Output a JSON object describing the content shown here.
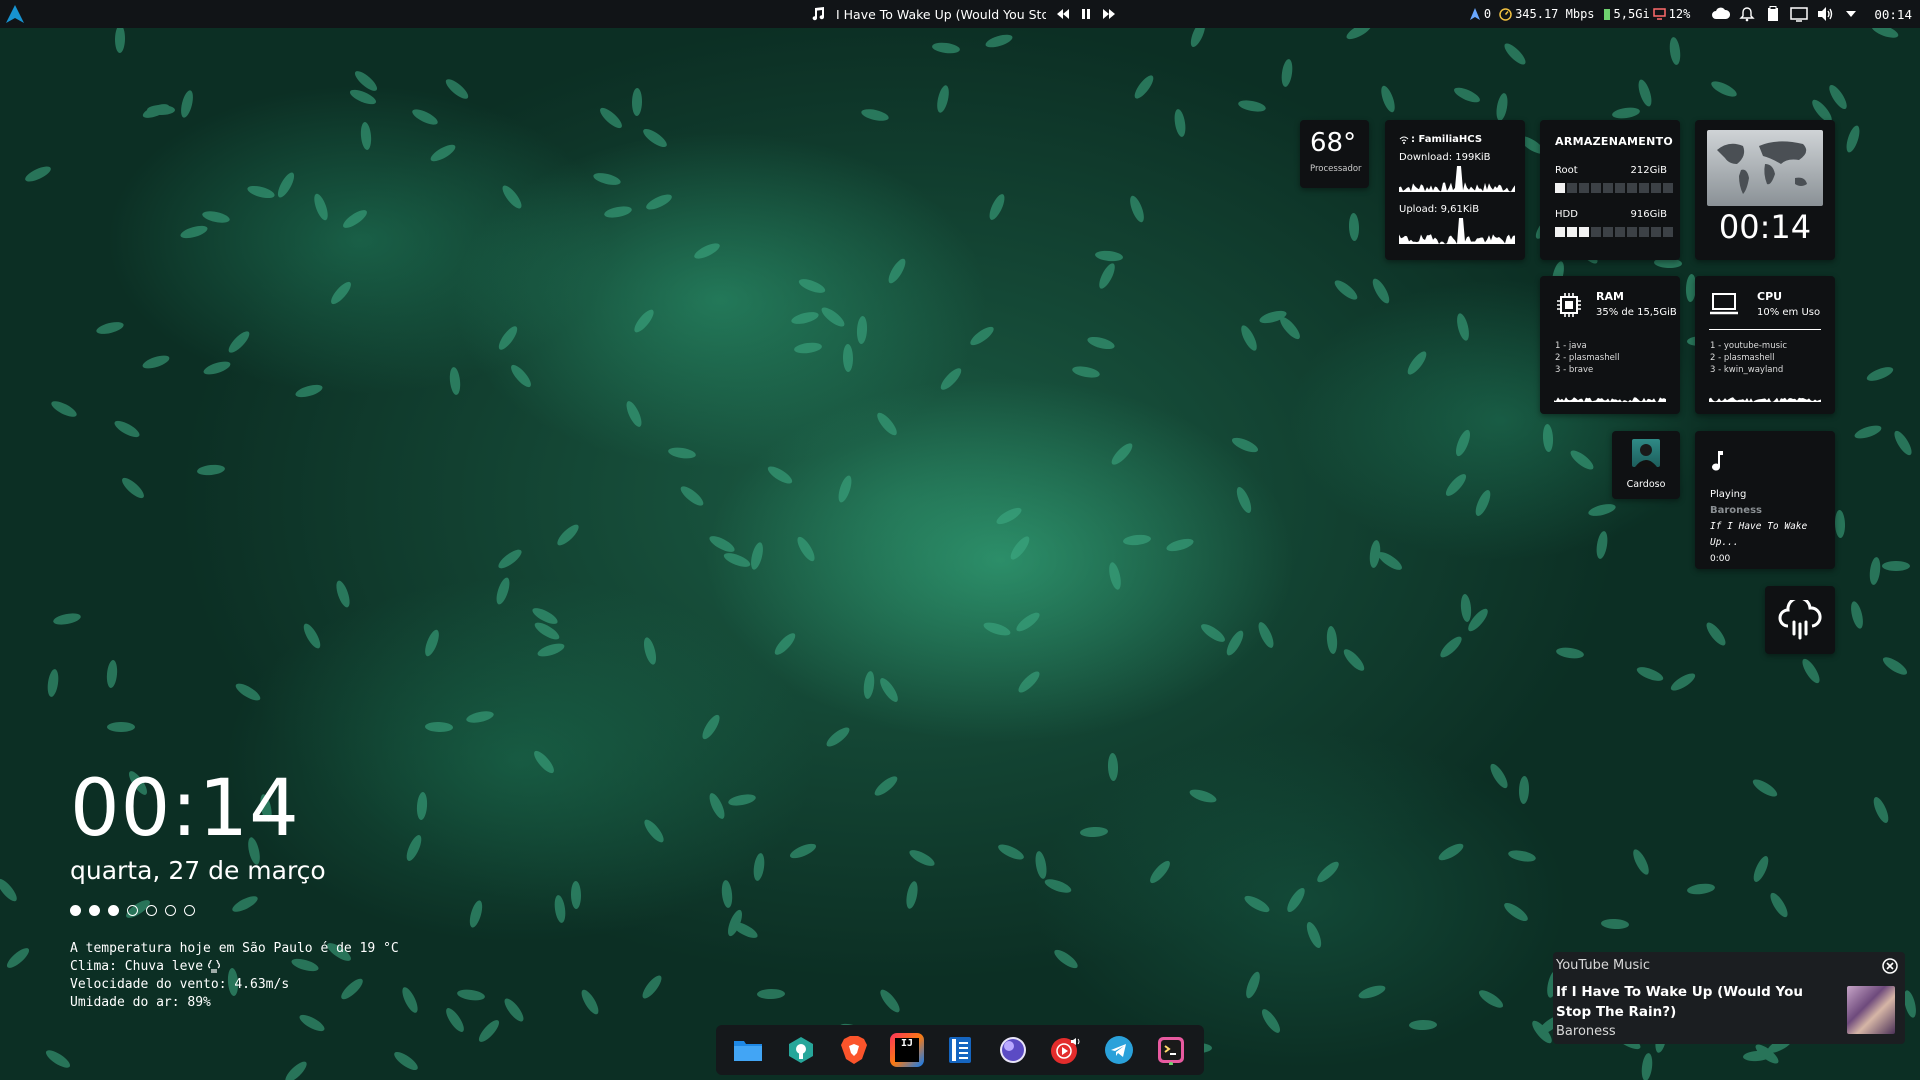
{
  "panel": {
    "track_title": "I Have To Wake Up (Would You Stop The Rain?)",
    "updates_count": "0",
    "net_speed": "345.17 Mbps",
    "memory": "5,5Gi",
    "cpu_percent": "12%",
    "clock": "00:14",
    "launcher_icon": "arch-icon"
  },
  "widgets": {
    "temp": {
      "value": "68°",
      "label": "Processador"
    },
    "network": {
      "ssid": ": FamiliaHCS",
      "download": "Download: 199KiB",
      "upload": "Upload: 9,61KiB"
    },
    "storage": {
      "title": "ARMAZENAMENTO",
      "drives": [
        {
          "name": "Root",
          "size": "212GiB",
          "fill": 0.1
        },
        {
          "name": "HDD",
          "size": "916GiB",
          "fill": 0.3
        }
      ]
    },
    "world_clock": {
      "time": "00:14"
    },
    "ram": {
      "title": "RAM",
      "usage": "35% de 15,5GiB",
      "procs": [
        "1 - java",
        "2 - plasmashell",
        "3 - brave"
      ]
    },
    "cpu": {
      "title": "CPU",
      "usage": "10% em Uso",
      "procs": [
        "1 - youtube-music",
        "2 - plasmashell",
        "3 - kwin_wayland"
      ]
    },
    "user": {
      "name": "Cardoso"
    },
    "player": {
      "status": "Playing",
      "artist": "Baroness",
      "title": "If I Have To Wake Up...",
      "time": "0:00"
    }
  },
  "desktop_clock": {
    "time": "00:14",
    "date": "quarta, 27 de março",
    "dots_on": 3,
    "dots_total": 7
  },
  "weather": {
    "line1": "A temperatura hoje em São Paulo é de 19 °C",
    "line2": "Clima: Chuva leve",
    "line3": "Velocidade do vento: 4.63m/s",
    "line4": "Umidade do ar: 89%"
  },
  "dock": {
    "apps": [
      "file-manager-icon",
      "green-app-icon",
      "brave-icon",
      "intellij-icon",
      "notes-icon",
      "purple-orb-icon",
      "youtube-music-icon",
      "telegram-icon",
      "terminal-icon"
    ]
  },
  "notification": {
    "app": "YouTube Music",
    "title": "If I Have To Wake Up (Would You Stop The Rain?)",
    "artist": "Baroness"
  },
  "colors": {
    "panel_bg": "#111417",
    "widget_bg": "#0f1113",
    "accent_blue": "#1793d1",
    "yt_red": "#e32c2c"
  }
}
